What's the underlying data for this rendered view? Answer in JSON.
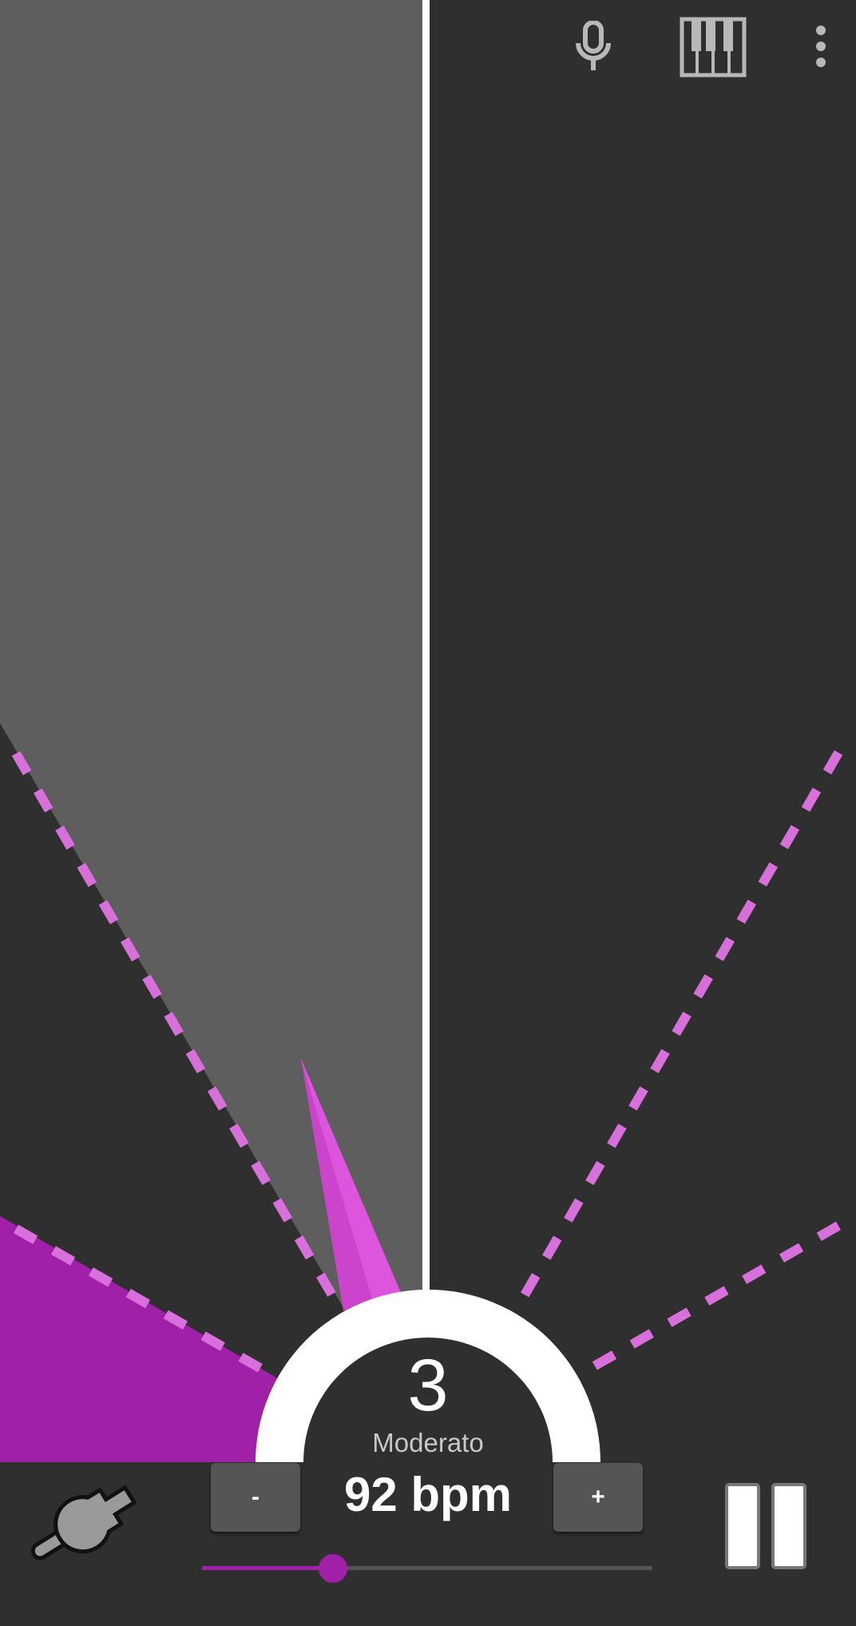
{
  "toolbar": {
    "mic_icon": "microphone-icon",
    "piano_icon": "piano-keyboard-icon",
    "menu_icon": "more-vertical-icon"
  },
  "metronome": {
    "current_beat": "3",
    "tempo_marking": "Moderato",
    "bpm_label": "92 bpm",
    "bpm": 92,
    "decrease_label": "-",
    "increase_label": "+",
    "slider_fraction": 0.29
  },
  "bottom_bar": {
    "settings_icon": "wrench-icon",
    "pause_icon": "pause-icon"
  },
  "colors": {
    "background": "#2f2f2f",
    "swing_shade": "#5e5e5e",
    "accent": "#a020a8",
    "dash": "#d870dc",
    "needle": "#cc44cc",
    "dial": "#ffffff"
  }
}
